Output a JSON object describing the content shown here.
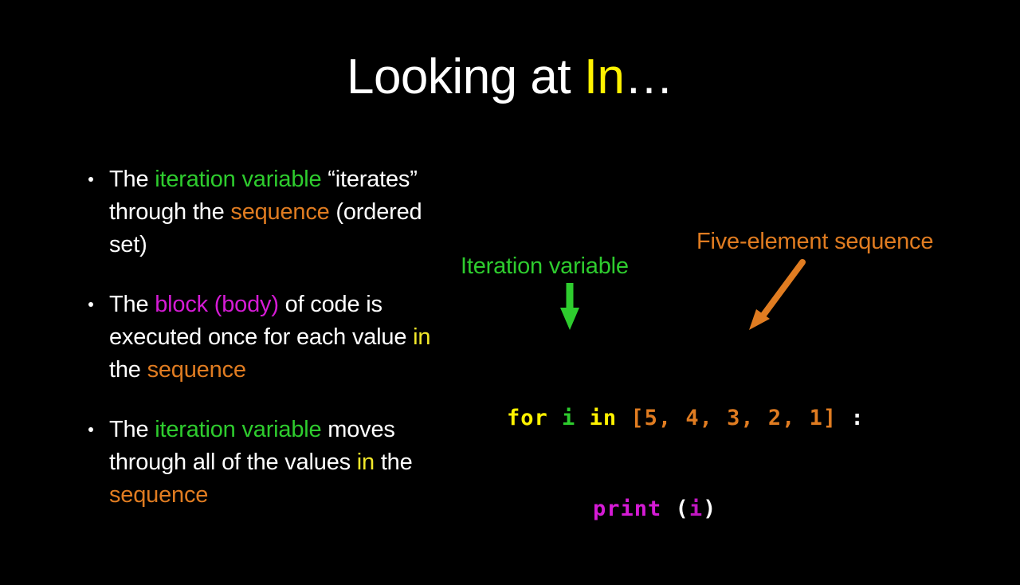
{
  "slide": {
    "background_color": "#000000",
    "title": {
      "prefix": "Looking at ",
      "keyword": "In",
      "ellipsis": "…"
    },
    "bullets": [
      {
        "name": "bullet-iteration-variable",
        "segments": [
          {
            "text": "The ",
            "color_role": "white"
          },
          {
            "text": "iteration variable",
            "color_role": "green"
          },
          {
            "text": " “iterates” through the ",
            "color_role": "white"
          },
          {
            "text": "sequence",
            "color_role": "orange"
          },
          {
            "text": " (ordered set)",
            "color_role": "white"
          }
        ]
      },
      {
        "name": "bullet-block-body",
        "segments": [
          {
            "text": "The ",
            "color_role": "white"
          },
          {
            "text": "block (body)",
            "color_role": "magenta"
          },
          {
            "text": " of code is executed once for each value ",
            "color_role": "white"
          },
          {
            "text": "in",
            "color_role": "yellow"
          },
          {
            "text": " the ",
            "color_role": "white"
          },
          {
            "text": "sequence",
            "color_role": "orange"
          }
        ]
      },
      {
        "name": "bullet-moves-through-values",
        "segments": [
          {
            "text": "The ",
            "color_role": "white"
          },
          {
            "text": "iteration variable",
            "color_role": "green"
          },
          {
            "text": " moves through all of the values ",
            "color_role": "white"
          },
          {
            "text": "in",
            "color_role": "yellow"
          },
          {
            "text": " the ",
            "color_role": "white"
          },
          {
            "text": "sequence",
            "color_role": "orange"
          }
        ]
      }
    ],
    "annotations": {
      "iteration_variable_label": "Iteration variable",
      "five_element_sequence_label": "Five-element sequence",
      "arrow_down_icon": "arrow-down-icon",
      "arrow_diagonal_icon": "arrow-diagonal-down-left-icon"
    },
    "code": {
      "line1": {
        "keyword_for": "for",
        "variable": "i",
        "keyword_in": "in",
        "list": "[5, 4, 3, 2, 1]",
        "colon": ":"
      },
      "line2": {
        "function": "print",
        "open_paren": "(",
        "argument": "i",
        "close_paren": ")"
      },
      "sequence_values": [
        5,
        4,
        3,
        2,
        1
      ]
    },
    "colors": {
      "white": "#FFFFFF",
      "green": "#2ECC2E",
      "orange": "#E07C21",
      "magenta": "#D51BD5",
      "yellow": "#F2E82A",
      "title_yellow": "#FFF200",
      "background": "#000000"
    }
  }
}
